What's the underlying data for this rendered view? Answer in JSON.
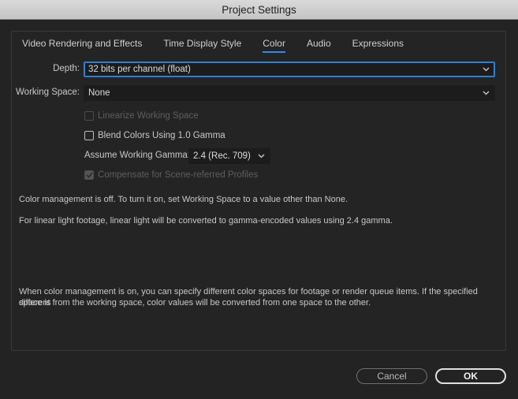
{
  "window": {
    "title": "Project Settings"
  },
  "tabs": [
    {
      "label": "Video Rendering and Effects",
      "active": false
    },
    {
      "label": "Time Display Style",
      "active": false
    },
    {
      "label": "Color",
      "active": true
    },
    {
      "label": "Audio",
      "active": false
    },
    {
      "label": "Expressions",
      "active": false
    }
  ],
  "depth": {
    "label": "Depth:",
    "value": "32 bits per channel (float)"
  },
  "working_space": {
    "label": "Working Space:",
    "value": "None"
  },
  "options": {
    "linearize": {
      "label": "Linearize Working Space",
      "checked": false,
      "enabled": false
    },
    "blend_gamma": {
      "label": "Blend Colors Using 1.0 Gamma",
      "checked": false,
      "enabled": true
    },
    "assume_gamma": {
      "label": "Assume Working Gamma:",
      "value": "2.4 (Rec. 709)"
    },
    "compensate": {
      "label": "Compensate for Scene-referred Profiles",
      "checked": true,
      "enabled": false
    }
  },
  "info": {
    "line1": "Color management is off. To turn it on, set Working Space to a value other than None.",
    "line2": "For linear light footage, linear light will be converted to gamma-encoded values using 2.4 gamma.",
    "line3a": "When color management is on, you can specify different color spaces for footage or render queue items. If the specified space is",
    "line3b": "different from the working space, color values will be converted from one space to the other."
  },
  "buttons": {
    "cancel": "Cancel",
    "ok": "OK"
  },
  "colors": {
    "accent": "#2d8ceb",
    "background": "#232323",
    "title_bar": "#cfcfcf"
  }
}
